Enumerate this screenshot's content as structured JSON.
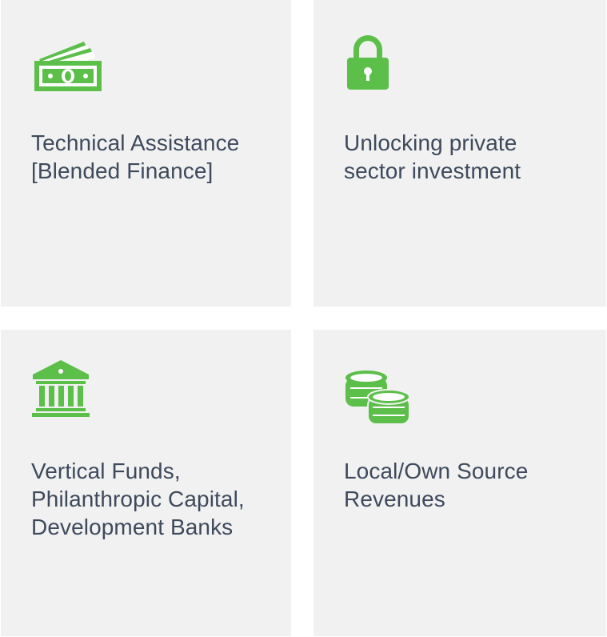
{
  "accent_color": "#5cbf4a",
  "card_bg_color": "#f1f1f1",
  "text_color": "#3e4a5c",
  "cards": [
    {
      "icon": "money-bills-icon",
      "label_lines": [
        "Technical Assistance",
        "[Blended Finance]"
      ]
    },
    {
      "icon": "padlock-icon",
      "label_lines": [
        "Unlocking private",
        "sector investment"
      ]
    },
    {
      "icon": "bank-building-icon",
      "label_lines": [
        "Vertical Funds,",
        "Philanthropic Capital,",
        "Development Banks"
      ]
    },
    {
      "icon": "coin-stacks-icon",
      "label_lines": [
        "Local/Own Source",
        "Revenues"
      ]
    }
  ]
}
